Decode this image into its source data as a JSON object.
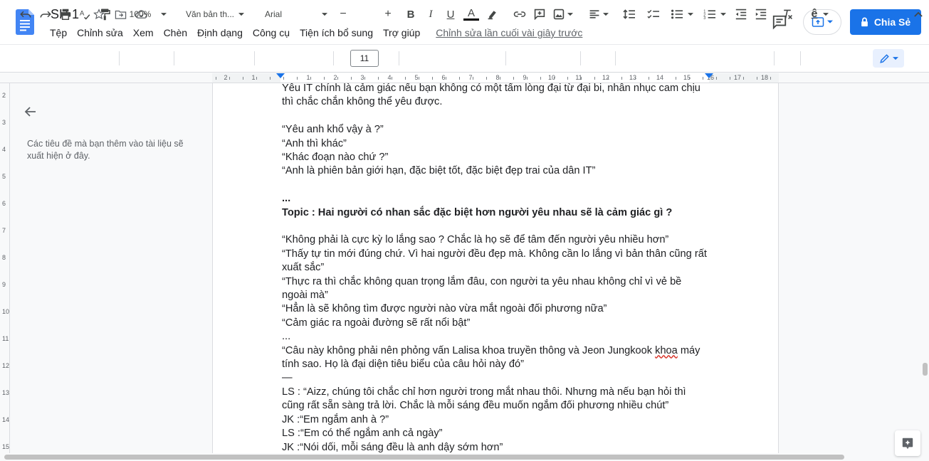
{
  "header": {
    "title": "SH 1",
    "menu": [
      "Tệp",
      "Chỉnh sửa",
      "Xem",
      "Chèn",
      "Định dạng",
      "Công cụ",
      "Tiện ích bổ sung",
      "Trợ giúp"
    ],
    "last_edit": "Chỉnh sửa lần cuối vài giây trước",
    "share_label": "Chia Sẻ"
  },
  "toolbar": {
    "zoom": "100%",
    "style": "Văn bản th...",
    "font": "Arial",
    "font_size": "11",
    "minus": "−",
    "plus": "+",
    "bold": "B",
    "italic": "I",
    "underline": "U",
    "text_color": "A",
    "spell_glyph": "ê"
  },
  "ruler": {
    "numbers": [
      "2",
      "1",
      "1",
      "2",
      "3",
      "4",
      "5",
      "6",
      "7",
      "8",
      "9",
      "10",
      "11",
      "12",
      "13",
      "14",
      "15",
      "16",
      "17",
      "18"
    ]
  },
  "vruler": {
    "numbers": [
      "2",
      "3",
      "4",
      "5",
      "6",
      "7",
      "8",
      "9",
      "10",
      "11",
      "12",
      "13",
      "14",
      "15"
    ]
  },
  "outline": {
    "hint": "Các tiêu đề mà bạn thêm vào tài liệu sẽ xuất hiện ở đây."
  },
  "document": {
    "lines": [
      {
        "text": "Yêu IT chính là cảm giác nếu bạn không có một tấm lòng đại từ đại bi, nhẫn nhục cam chịu",
        "style": "normal"
      },
      {
        "text": "thì chắc chắn không thể yêu được.",
        "style": "normal"
      },
      {
        "text": "",
        "style": "normal"
      },
      {
        "text": "“Yêu anh khổ vậy à ?”",
        "style": "normal"
      },
      {
        "text": "“Anh thì khác”",
        "style": "normal"
      },
      {
        "text": "“Khác đoạn nào chứ ?”",
        "style": "normal"
      },
      {
        "text": "“Anh là phiên bản giới hạn, đặc biệt tốt, đặc biệt đẹp trai của dân IT”",
        "style": "normal"
      },
      {
        "text": "",
        "style": "normal"
      },
      {
        "text": "...",
        "style": "bold"
      },
      {
        "text": "Topic : Hai người có nhan sắc đặc biệt hơn người yêu nhau sẽ là cảm giác gì ?",
        "style": "bold"
      },
      {
        "text": "",
        "style": "normal"
      },
      {
        "text": "“Không phải là cực kỳ lo lắng sao ? Chắc là họ sẽ để tâm đến người yêu nhiều hơn”",
        "style": "normal"
      },
      {
        "text": "“Thấy tự tin mới đúng chứ. Vì hai người đều đẹp mà. Không cần lo lắng vì bản thân cũng rất",
        "style": "normal"
      },
      {
        "text": "xuất sắc”",
        "style": "normal"
      },
      {
        "text": "“Thực ra thì chắc không quan trọng lắm đâu, con người ta yêu nhau không chỉ vì vẻ bề",
        "style": "normal"
      },
      {
        "text": "ngoài mà”",
        "style": "normal"
      },
      {
        "text": "“Hẳn là sẽ không tìm được người nào vừa mắt ngoài đối phương nữa”",
        "style": "normal"
      },
      {
        "text": "“Cảm giác ra ngoài đường sẽ rất nổi bật”",
        "style": "normal"
      },
      {
        "text": "...",
        "style": "normal"
      },
      {
        "text_before": "“Câu này không phải nên phỏng vấn Lalisa khoa truyền thông và Jeon Jungkook ",
        "squiggle": "khoa",
        "text_after": " máy",
        "style": "squiggle"
      },
      {
        "text": "tính sao. Họ là đại diện tiêu biểu của câu hỏi này đó”",
        "style": "normal"
      },
      {
        "text": "—",
        "style": "normal"
      },
      {
        "text": "LS : “Aizz, chúng tôi chắc chỉ hơn người trong mắt nhau thôi. Nhưng mà nếu bạn hỏi thì",
        "style": "normal"
      },
      {
        "text": "cũng rất sẵn sàng trả lời. Chắc là mỗi sáng đều muốn ngắm đối phương nhiều chút”",
        "style": "normal"
      },
      {
        "text": "JK :“Em ngắm anh à ?”",
        "style": "normal"
      },
      {
        "text": "LS :“Em có thể ngắm anh cả ngày”",
        "style": "normal"
      },
      {
        "text": "JK :“Nói dối, mỗi sáng đều là anh dậy sớm hơn”",
        "style": "normal"
      }
    ]
  },
  "colors": {
    "accent": "#1a73e8",
    "doc_icon": "#4285f4"
  }
}
